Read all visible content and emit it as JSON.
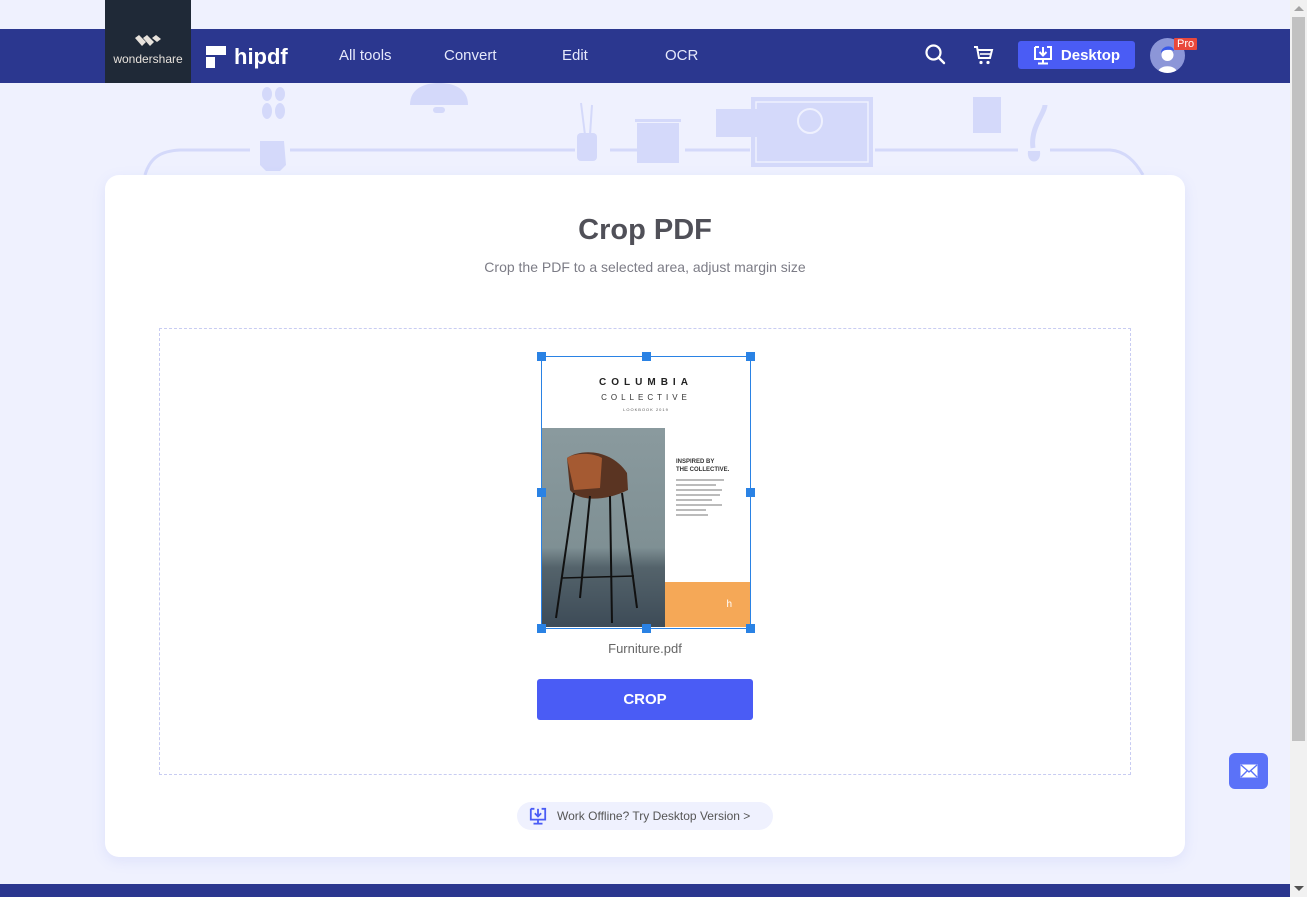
{
  "header": {
    "company_logo": "wondershare",
    "brand": "hipdf",
    "nav": [
      "All tools",
      "Convert",
      "Edit",
      "OCR"
    ],
    "desktop_button": "Desktop",
    "pro_badge": "Pro",
    "icons": {
      "search": "search-icon",
      "cart": "cart-icon",
      "desktop": "desktop-download-icon",
      "avatar": "user-avatar-icon"
    }
  },
  "page": {
    "title": "Crop PDF",
    "subtitle": "Crop the PDF to a selected area, adjust margin size"
  },
  "preview": {
    "doc_title": "COLUMBIA",
    "doc_subtitle": "COLLECTIVE",
    "doc_tagline": "LOOKBOOK 2019",
    "side_heading_1": "INSPIRED BY",
    "side_heading_2": "THE COLLECTIVE.",
    "corner_glyph": "h",
    "filename": "Furniture.pdf"
  },
  "actions": {
    "crop_button": "CROP",
    "offline_link": "Work Offline? Try Desktop Version >"
  },
  "colors": {
    "header_bg": "#2b378f",
    "accent": "#4a5cf5",
    "page_bg": "#eff1fe",
    "crop_frame": "#2a82e4",
    "pro_badge": "#e9483b"
  }
}
